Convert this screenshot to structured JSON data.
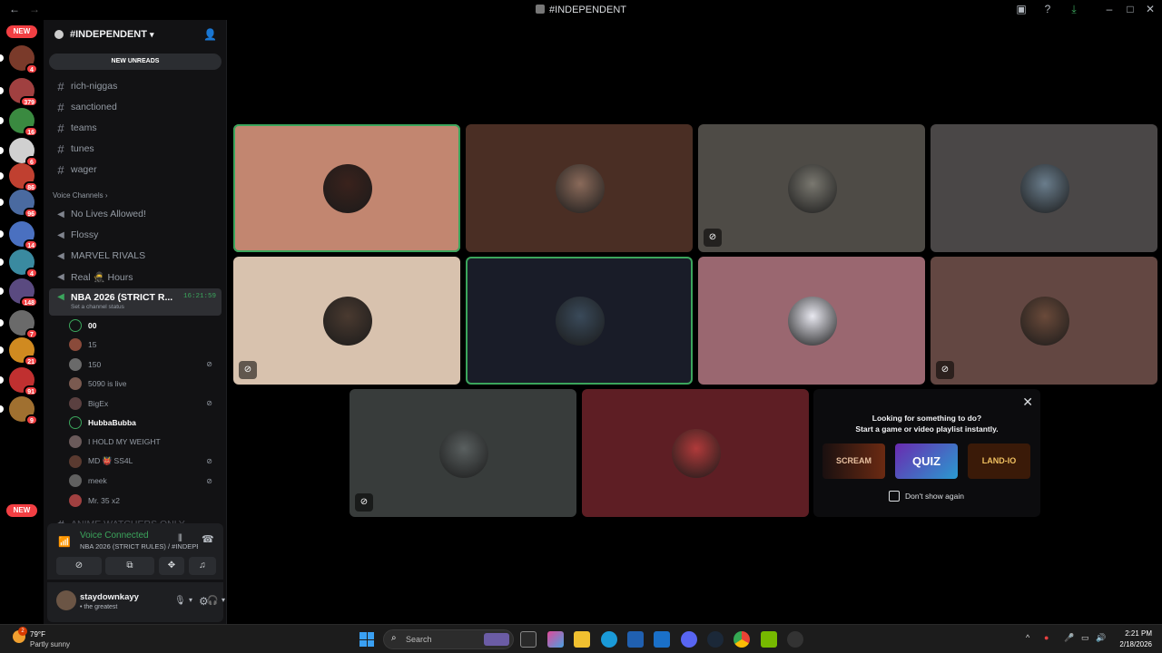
{
  "window": {
    "title": "#INDEPENDENT",
    "back": "←",
    "forward": "→"
  },
  "rail": {
    "new_top": "NEW",
    "new_bottom": "NEW",
    "badges": [
      "4",
      "379",
      "16",
      "6",
      "86",
      "96",
      "14",
      "4",
      "148",
      "7",
      "21",
      "91",
      "9"
    ]
  },
  "sidebar": {
    "guild_name": "#INDEPENDENT",
    "new_unreads": "NEW UNREADS",
    "text_channels": [
      "rich-niggas",
      "sanctioned",
      "teams",
      "tunes",
      "wager"
    ],
    "voice_header": "Voice Channels",
    "voice_channels": [
      "No Lives Allowed!",
      "Flossy",
      "MARVEL RIVALS",
      "Real 🥷 Hours"
    ],
    "active_channel": {
      "name": "NBA 2026 (STRICT R...",
      "timer": "16:21:59",
      "status": "Set a channel status"
    },
    "members": [
      {
        "name": "00",
        "bright": true,
        "ring": true,
        "muted": false
      },
      {
        "name": "15",
        "bright": false,
        "ring": false,
        "muted": false
      },
      {
        "name": "150",
        "bright": false,
        "ring": false,
        "muted": true
      },
      {
        "name": "5090 is live",
        "bright": false,
        "ring": false,
        "muted": false
      },
      {
        "name": "BigEx",
        "bright": false,
        "ring": false,
        "muted": true
      },
      {
        "name": "HubbaBubba",
        "bright": true,
        "ring": true,
        "muted": false
      },
      {
        "name": "I HOLD MY WEIGHT",
        "bright": false,
        "ring": false,
        "muted": false
      },
      {
        "name": "MD 👹 SS4L",
        "bright": false,
        "ring": false,
        "muted": true
      },
      {
        "name": "meek",
        "bright": false,
        "ring": false,
        "muted": true
      },
      {
        "name": "Mr. 35 x2",
        "bright": false,
        "ring": false,
        "muted": false
      }
    ],
    "cutoff_channel": "ANIME WATCHERS ONLY"
  },
  "voice_panel": {
    "status": "Voice Connected",
    "channel": "NBA 2026 (STRICT RULES) / #INDEPEN..."
  },
  "user_panel": {
    "username": "staydownkayy",
    "status": "• the greatest"
  },
  "tiles": [
    {
      "bg": "#c28670",
      "av": "#3a221c",
      "speaking": true,
      "muted": false
    },
    {
      "bg": "#4a2e24",
      "av": "#8a6a5a",
      "speaking": false,
      "muted": false
    },
    {
      "bg": "#4e4b46",
      "av": "#7a7870",
      "speaking": false,
      "muted": true
    },
    {
      "bg": "#4a4747",
      "av": "#6a7d8c",
      "speaking": false,
      "muted": false
    },
    {
      "bg": "#d8c2ae",
      "av": "#4a3a30",
      "speaking": false,
      "muted": true
    },
    {
      "bg": "#191c28",
      "av": "#3a4a5a",
      "speaking": true,
      "muted": false
    },
    {
      "bg": "#9a6770",
      "av": "#e8e8f0",
      "speaking": false,
      "muted": false
    },
    {
      "bg": "#634742",
      "av": "#6a4a3a",
      "speaking": false,
      "muted": true
    },
    {
      "bg": "#383c3b",
      "av": "#5a6060",
      "speaking": false,
      "muted": true
    },
    {
      "bg": "#5e1e24",
      "av": "#b03a3a",
      "speaking": false,
      "muted": false
    }
  ],
  "activity": {
    "line1": "Looking for something to do?",
    "line2": "Start a game or video playlist instantly.",
    "cards": [
      "SCREAM",
      "QUIZ",
      "LAND-IO"
    ],
    "checkbox": "Don't show again"
  },
  "taskbar": {
    "weather_temp": "79°F",
    "weather_cond": "Partly sunny",
    "weather_badge": "2",
    "search_placeholder": "Search",
    "time": "2:21 PM",
    "date": "2/18/2026"
  }
}
